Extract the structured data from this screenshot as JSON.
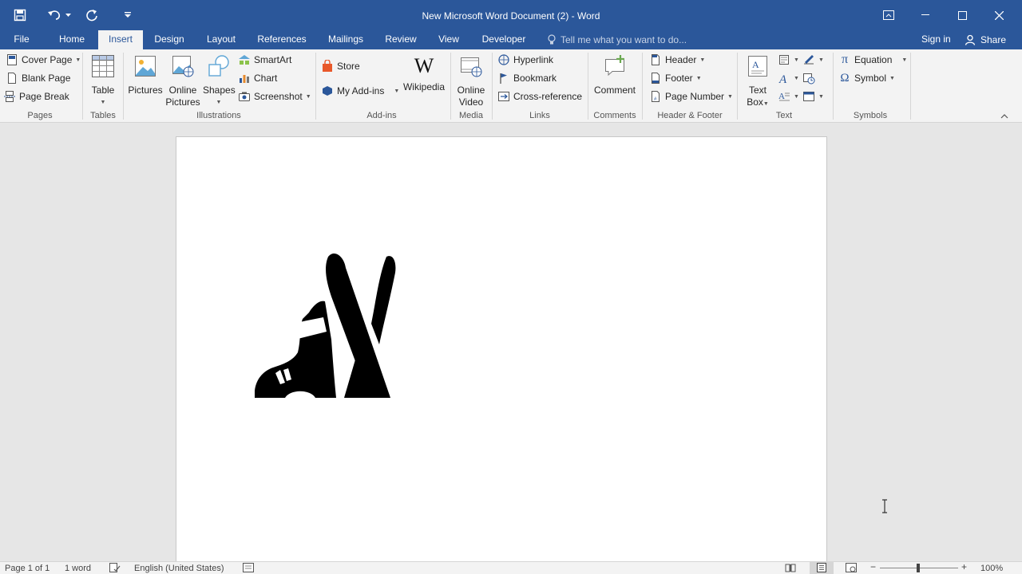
{
  "window": {
    "title": "New Microsoft Word Document (2) - Word"
  },
  "tabs": [
    {
      "label": "File"
    },
    {
      "label": "Home"
    },
    {
      "label": "Insert"
    },
    {
      "label": "Design"
    },
    {
      "label": "Layout"
    },
    {
      "label": "References"
    },
    {
      "label": "Mailings"
    },
    {
      "label": "Review"
    },
    {
      "label": "View"
    },
    {
      "label": "Developer"
    }
  ],
  "tellme": {
    "placeholder": "Tell me what you want to do..."
  },
  "account": {
    "signin": "Sign in",
    "share": "Share"
  },
  "ribbon": {
    "pages": {
      "label": "Pages",
      "cover_page": "Cover Page",
      "blank_page": "Blank Page",
      "page_break": "Page Break"
    },
    "tables": {
      "label": "Tables",
      "table": "Table"
    },
    "illustrations": {
      "label": "Illustrations",
      "pictures": "Pictures",
      "online_pictures_1": "Online",
      "online_pictures_2": "Pictures",
      "shapes": "Shapes",
      "smartart": "SmartArt",
      "chart": "Chart",
      "screenshot": "Screenshot"
    },
    "addins": {
      "label": "Add-ins",
      "store": "Store",
      "my_addins": "My Add-ins",
      "wikipedia": "Wikipedia"
    },
    "media": {
      "label": "Media",
      "online_video_1": "Online",
      "online_video_2": "Video"
    },
    "links": {
      "label": "Links",
      "hyperlink": "Hyperlink",
      "bookmark": "Bookmark",
      "cross_reference": "Cross-reference"
    },
    "comments": {
      "label": "Comments",
      "comment": "Comment"
    },
    "header_footer": {
      "label": "Header & Footer",
      "header": "Header",
      "footer": "Footer",
      "page_number": "Page Number"
    },
    "text": {
      "label": "Text",
      "text_box_1": "Text",
      "text_box_2": "Box"
    },
    "symbols": {
      "label": "Symbols",
      "equation": "Equation",
      "symbol": "Symbol"
    }
  },
  "status": {
    "page": "Page 1 of 1",
    "words": "1 word",
    "language": "English (United States)",
    "zoom": "100%"
  },
  "colors": {
    "accent": "#2b579a",
    "ribbon_bg": "#f3f3f3",
    "canvas_bg": "#e6e6e6"
  }
}
